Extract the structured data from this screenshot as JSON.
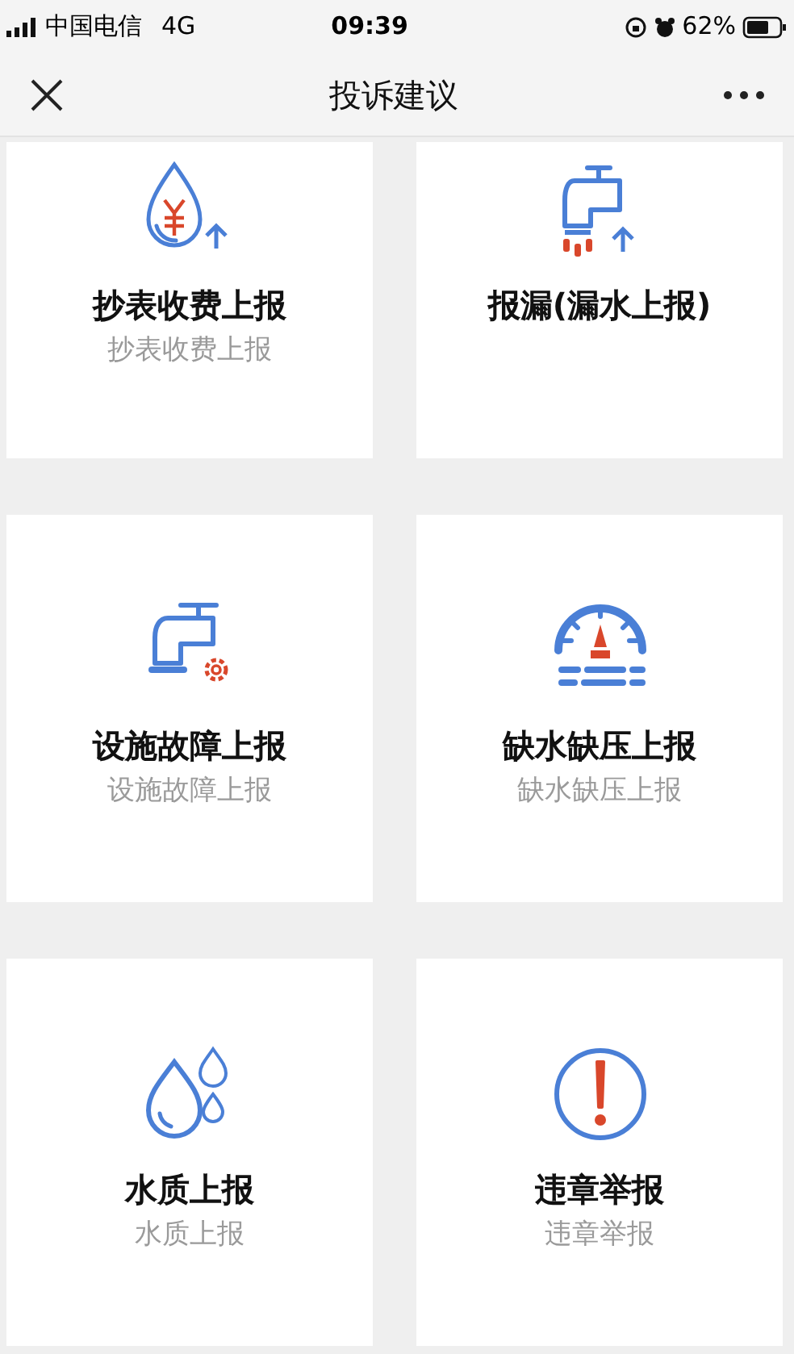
{
  "status_bar": {
    "carrier": "中国电信",
    "network": "4G",
    "time": "09:39",
    "battery": "62%"
  },
  "nav": {
    "title": "投诉建议"
  },
  "cards": [
    {
      "kind": "drop-yen",
      "title": "抄表收费上报",
      "subtitle": "抄表收费上报"
    },
    {
      "kind": "tap-leak",
      "title": "报漏(漏水上报)"
    },
    {
      "kind": "tap-gear",
      "title": "设施故障上报",
      "subtitle": "设施故障上报"
    },
    {
      "kind": "gauge",
      "title": "缺水缺压上报",
      "subtitle": "缺水缺压上报"
    },
    {
      "kind": "drops",
      "title": "水质上报",
      "subtitle": "水质上报"
    },
    {
      "kind": "alert",
      "title": "违章举报",
      "subtitle": "违章举报"
    }
  ]
}
